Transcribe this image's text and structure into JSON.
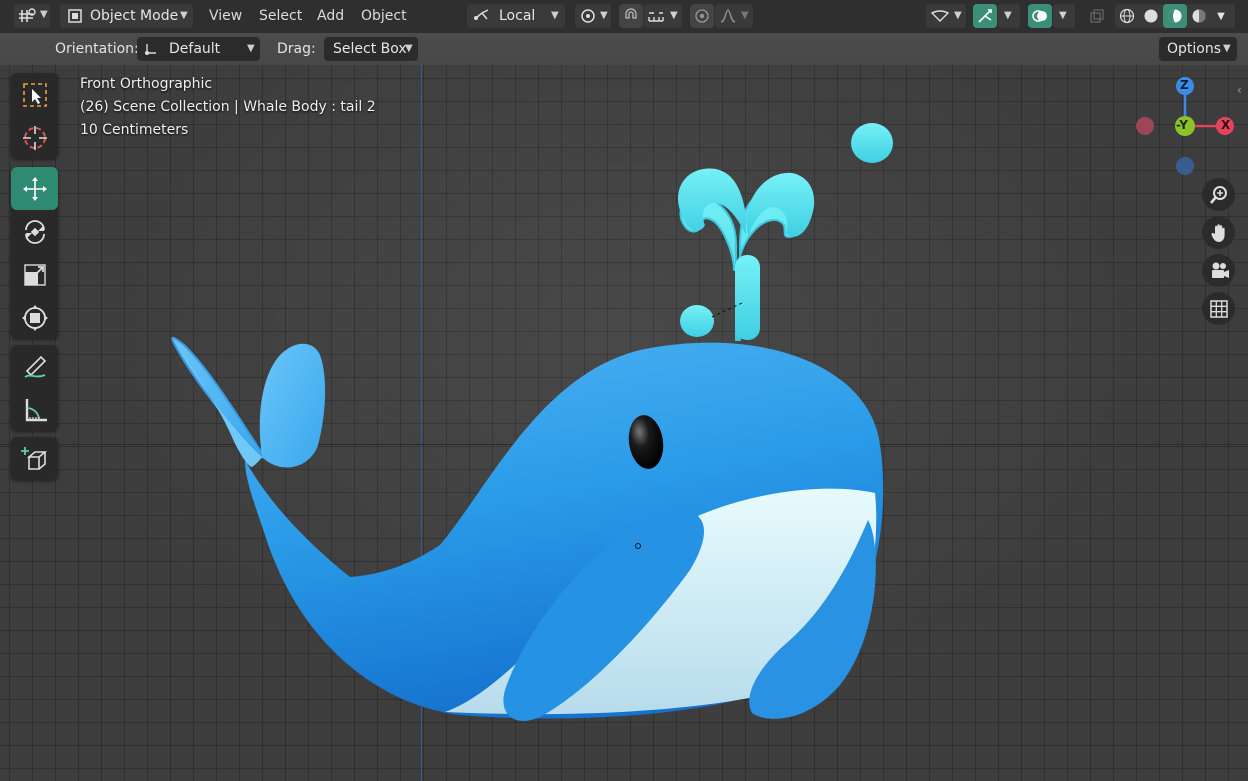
{
  "header": {
    "mode_label": "Object Mode",
    "menus": [
      "View",
      "Select",
      "Add",
      "Object"
    ],
    "transform_pivot": "Local"
  },
  "toolbar": {
    "orientation_label": "Orientation:",
    "orientation_value": "Default",
    "drag_label": "Drag:",
    "drag_value": "Select Box",
    "options_label": "Options"
  },
  "viewport": {
    "view_name": "Front Orthographic",
    "collection_info": "(26) Scene Collection | Whale Body : tail 2",
    "scale_info": "10 Centimeters"
  },
  "gizmo": {
    "axis_z": "Z",
    "axis_x": "X",
    "axis_neg_y": "-Y"
  },
  "left_tools": [
    "select-box-icon",
    "cursor-icon",
    "move-icon",
    "rotate-icon",
    "scale-icon",
    "transform-icon",
    "annotate-icon",
    "measure-icon",
    "add-cube-icon"
  ],
  "nav_buttons": [
    "zoom-icon",
    "hand-pan-icon",
    "camera-icon",
    "grid-ortho-icon"
  ],
  "colors": {
    "accent": "#2f8a72",
    "whale_body": "#2a9be8",
    "whale_belly": "#d8f4f8",
    "spout": "#5ee8ef",
    "axis_x": "#e2455b",
    "axis_y": "#8bc32a",
    "axis_z": "#3b8ce8"
  }
}
